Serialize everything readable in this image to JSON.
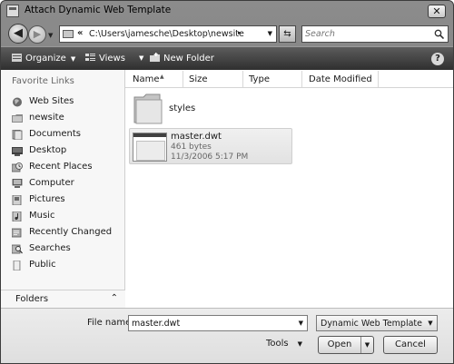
{
  "window": {
    "title": "Attach Dynamic Web Template",
    "close_label": "✕"
  },
  "address": {
    "chevrons": "«",
    "path": "C:\\Users\\jamesche\\Desktop\\newsite",
    "arrow": "▸",
    "search_placeholder": "Search"
  },
  "toolbar": {
    "organize": "Organize",
    "views": "Views",
    "new_folder": "New Folder",
    "help": "?"
  },
  "sidebar": {
    "heading": "Favorite Links",
    "items": [
      {
        "label": "Web Sites",
        "icon": "globe-icon"
      },
      {
        "label": "newsite",
        "icon": "folder-icon"
      },
      {
        "label": "Documents",
        "icon": "documents-icon"
      },
      {
        "label": "Desktop",
        "icon": "desktop-icon"
      },
      {
        "label": "Recent Places",
        "icon": "recent-places-icon"
      },
      {
        "label": "Computer",
        "icon": "computer-icon"
      },
      {
        "label": "Pictures",
        "icon": "pictures-icon"
      },
      {
        "label": "Music",
        "icon": "music-icon"
      },
      {
        "label": "Recently Changed",
        "icon": "recently-changed-icon"
      },
      {
        "label": "Searches",
        "icon": "searches-icon"
      },
      {
        "label": "Public",
        "icon": "public-icon"
      }
    ],
    "folders_label": "Folders"
  },
  "columns": {
    "name": "Name",
    "size": "Size",
    "type": "Type",
    "date": "Date Modified"
  },
  "files": {
    "folder": {
      "name": "styles"
    },
    "file": {
      "name": "master.dwt",
      "size": "461 bytes",
      "date": "11/3/2006 5:17 PM"
    }
  },
  "bottom": {
    "file_name_label": "File name:",
    "file_name_value": "master.dwt",
    "filter": "Dynamic Web Template (*.dw",
    "tools": "Tools",
    "open": "Open",
    "cancel": "Cancel"
  }
}
